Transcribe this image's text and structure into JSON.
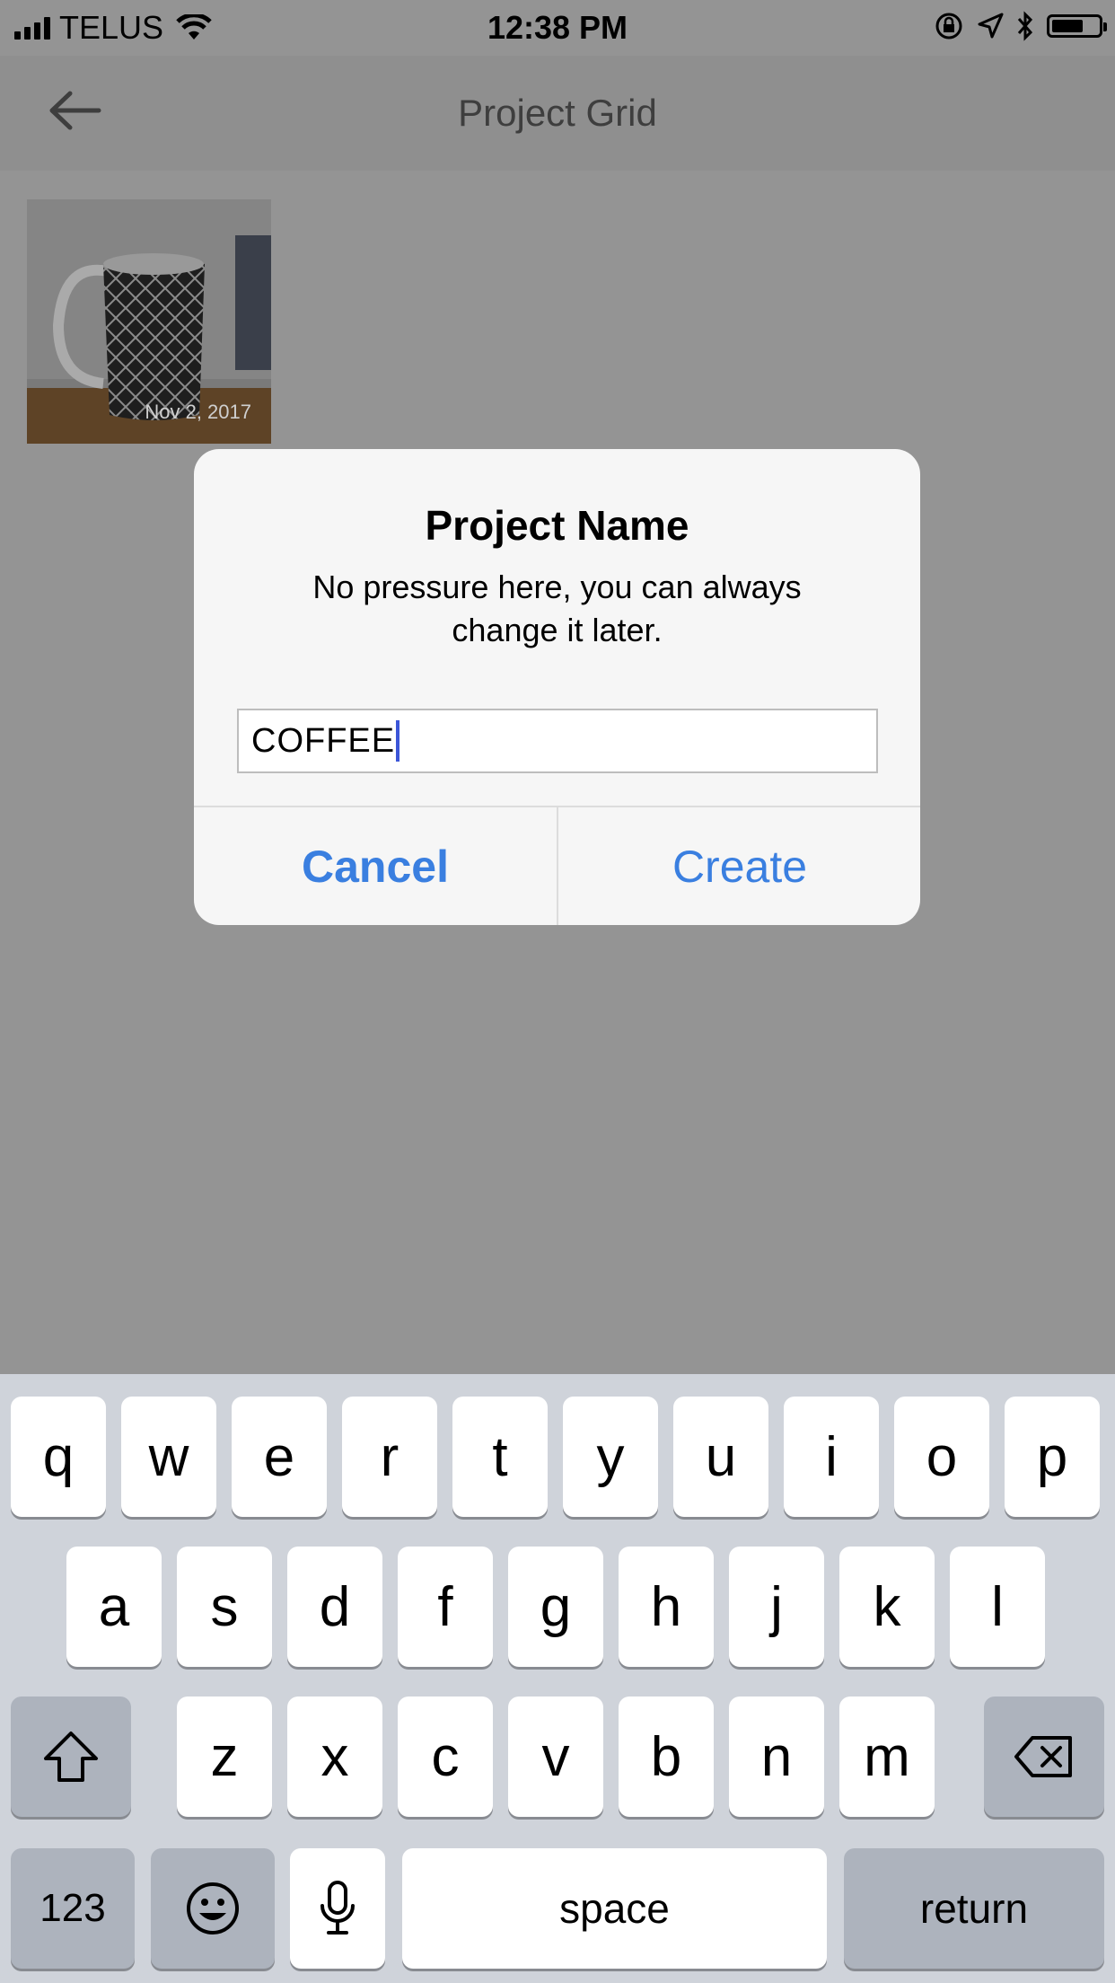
{
  "status_bar": {
    "carrier": "TELUS",
    "time": "12:38 PM"
  },
  "nav": {
    "title": "Project Grid",
    "back_icon": "back-arrow-icon"
  },
  "grid": {
    "items": [
      {
        "date": "Nov 2, 2017"
      }
    ]
  },
  "dialog": {
    "title": "Project Name",
    "message": "No pressure here, you can always change it later.",
    "input_value": "COFFEE",
    "cancel_label": "Cancel",
    "create_label": "Create"
  },
  "keyboard": {
    "row1": [
      "q",
      "w",
      "e",
      "r",
      "t",
      "y",
      "u",
      "i",
      "o",
      "p"
    ],
    "row2": [
      "a",
      "s",
      "d",
      "f",
      "g",
      "h",
      "j",
      "k",
      "l"
    ],
    "row3": [
      "z",
      "x",
      "c",
      "v",
      "b",
      "n",
      "m"
    ],
    "numbers_label": "123",
    "space_label": "space",
    "return_label": "return",
    "icons": {
      "shift": "shift-icon",
      "delete": "delete-icon",
      "emoji": "emoji-icon",
      "mic": "microphone-icon"
    }
  },
  "colors": {
    "accent": "#3a7fe0",
    "overlay": "#949494",
    "keyboard_bg": "#cfd3da"
  }
}
